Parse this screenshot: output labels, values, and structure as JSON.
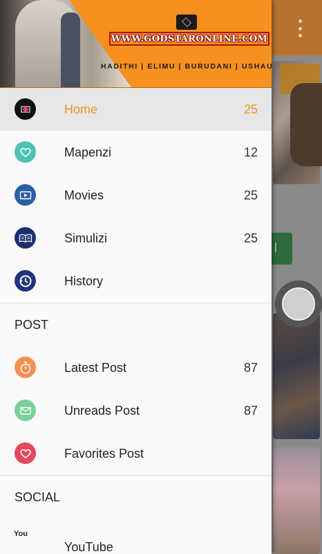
{
  "header": {
    "site": "WWW.GODSTARONLINE.COM",
    "tagline": "HADITHI | ELIMU | BURUDANI | USHAURI"
  },
  "menu": [
    {
      "label": "Home",
      "count": "25",
      "icon": "logo-icon",
      "color": "#111111",
      "active": true
    },
    {
      "label": "Mapenzi",
      "count": "12",
      "icon": "heart-icon",
      "color": "#4cc2b4"
    },
    {
      "label": "Movies",
      "count": "25",
      "icon": "video-icon",
      "color": "#2a5fa3"
    },
    {
      "label": "Simulizi",
      "count": "25",
      "icon": "book-icon",
      "color": "#1c2f6e"
    },
    {
      "label": "History",
      "count": "",
      "icon": "history-icon",
      "color": "#20347e"
    }
  ],
  "post_section": {
    "title": "POST",
    "items": [
      {
        "label": "Latest Post",
        "count": "87",
        "icon": "stopwatch-icon",
        "color": "#f59252"
      },
      {
        "label": "Unreads Post",
        "count": "87",
        "icon": "mail-icon",
        "color": "#7ccf98"
      },
      {
        "label": "Favorites Post",
        "count": "",
        "icon": "heart-icon",
        "color": "#e5485c"
      }
    ]
  },
  "social_section": {
    "title": "SOCIAL",
    "items": [
      {
        "label": "YouTube",
        "icon": "youtube-icon",
        "icon_text": "You"
      }
    ]
  },
  "colors": {
    "accent": "#f6921e",
    "header_bg": "#f6901e"
  }
}
